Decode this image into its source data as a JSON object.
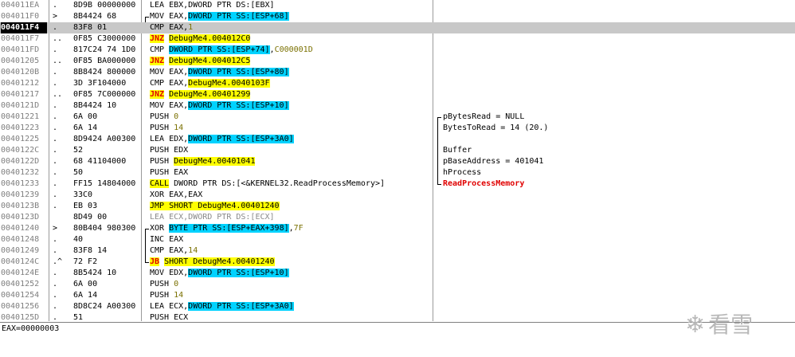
{
  "rows": [
    {
      "addr": "004011EA",
      "mark": ".",
      "hex": "8D9B 00000000",
      "asm": [
        {
          "t": "LEA EBX,DWORD PTR DS:[EBX]"
        }
      ]
    },
    {
      "addr": "004011F0",
      "mark": ">",
      "hex": "8B4424 68",
      "bracket": "top",
      "asm": [
        {
          "t": "MOV EAX,"
        },
        {
          "t": "DWORD PTR SS:[ESP+68]",
          "c": "reg"
        }
      ]
    },
    {
      "addr": "004011F4",
      "mark": ".",
      "hex": "83F8 01",
      "selected": true,
      "asm": [
        {
          "t": "CMP EAX,"
        },
        {
          "t": "1",
          "c": "num"
        }
      ]
    },
    {
      "addr": "004011F7",
      "mark": "..",
      "hex": "0F85 C3000000",
      "asm": [
        {
          "t": "JNZ",
          "c": "red"
        },
        {
          "t": " "
        },
        {
          "t": "DebugMe4.004012C0",
          "c": "mark"
        }
      ]
    },
    {
      "addr": "004011FD",
      "mark": ".",
      "hex": "817C24 74 1D0",
      "asm": [
        {
          "t": "CMP "
        },
        {
          "t": "DWORD PTR SS:[ESP+74]",
          "c": "reg"
        },
        {
          "t": ","
        },
        {
          "t": "C000001D",
          "c": "num"
        }
      ]
    },
    {
      "addr": "00401205",
      "mark": "..",
      "hex": "0F85 BA000000",
      "asm": [
        {
          "t": "JNZ",
          "c": "red"
        },
        {
          "t": " "
        },
        {
          "t": "DebugMe4.004012C5",
          "c": "mark"
        }
      ]
    },
    {
      "addr": "0040120B",
      "mark": ".",
      "hex": "8B8424 800000",
      "asm": [
        {
          "t": "MOV EAX,"
        },
        {
          "t": "DWORD PTR SS:[ESP+80]",
          "c": "reg"
        }
      ]
    },
    {
      "addr": "00401212",
      "mark": ".",
      "hex": "3D 3F104000",
      "asm": [
        {
          "t": "CMP EAX,"
        },
        {
          "t": "DebugMe4.0040103F",
          "c": "mark"
        }
      ]
    },
    {
      "addr": "00401217",
      "mark": "..",
      "hex": "0F85 7C000000",
      "asm": [
        {
          "t": "JNZ",
          "c": "red"
        },
        {
          "t": " "
        },
        {
          "t": "DebugMe4.00401299",
          "c": "mark"
        }
      ]
    },
    {
      "addr": "0040121D",
      "mark": ".",
      "hex": "8B4424 10",
      "asm": [
        {
          "t": "MOV EAX,"
        },
        {
          "t": "DWORD PTR SS:[ESP+10]",
          "c": "reg"
        }
      ]
    },
    {
      "addr": "00401221",
      "mark": ".",
      "hex": "6A 00",
      "asm": [
        {
          "t": "PUSH "
        },
        {
          "t": "0",
          "c": "num"
        }
      ],
      "comment": [
        {
          "t": "pBytesRead = NULL"
        }
      ],
      "cbracket": "top"
    },
    {
      "addr": "00401223",
      "mark": ".",
      "hex": "6A 14",
      "asm": [
        {
          "t": "PUSH "
        },
        {
          "t": "14",
          "c": "num"
        }
      ],
      "comment": [
        {
          "t": "BytesToRead = 14 (20.)"
        }
      ],
      "cbracket": "mid"
    },
    {
      "addr": "00401225",
      "mark": ".",
      "hex": "8D9424 A00300",
      "asm": [
        {
          "t": "LEA EDX,"
        },
        {
          "t": "DWORD PTR SS:[ESP+3A0]",
          "c": "reg"
        }
      ],
      "cbracket": "mid"
    },
    {
      "addr": "0040122C",
      "mark": ".",
      "hex": "52",
      "asm": [
        {
          "t": "PUSH EDX"
        }
      ],
      "comment": [
        {
          "t": "Buffer"
        }
      ],
      "cbracket": "mid"
    },
    {
      "addr": "0040122D",
      "mark": ".",
      "hex": "68 41104000",
      "asm": [
        {
          "t": "PUSH "
        },
        {
          "t": "DebugMe4.00401041",
          "c": "mark"
        }
      ],
      "comment": [
        {
          "t": "pBaseAddress = 401041"
        }
      ],
      "cbracket": "mid"
    },
    {
      "addr": "00401232",
      "mark": ".",
      "hex": "50",
      "asm": [
        {
          "t": "PUSH EAX"
        }
      ],
      "comment": [
        {
          "t": "hProcess"
        }
      ],
      "cbracket": "mid"
    },
    {
      "addr": "00401233",
      "mark": ".",
      "hex": "FF15 14804000",
      "asm": [
        {
          "t": "CALL",
          "c": "mark"
        },
        {
          "t": " DWORD PTR DS:[<&KERNEL32.ReadProcessMemory>]"
        }
      ],
      "comment": [
        {
          "t": "ReadProcessMemory",
          "c": "cmtred"
        }
      ],
      "cbracket": "bot"
    },
    {
      "addr": "00401239",
      "mark": ".",
      "hex": "33C0",
      "asm": [
        {
          "t": "XOR EAX,EAX"
        }
      ]
    },
    {
      "addr": "0040123B",
      "mark": ".",
      "hex": "EB 03",
      "asm": [
        {
          "t": "JMP SHORT DebugMe4.00401240",
          "c": "mark"
        }
      ]
    },
    {
      "addr": "0040123D",
      "mark": "",
      "hex": "8D49 00",
      "asm": [
        {
          "t": "LEA ECX,DWORD PTR DS:[ECX]",
          "c": "gray"
        }
      ]
    },
    {
      "addr": "00401240",
      "mark": ">",
      "hex": "80B404 980300",
      "bracket": "top",
      "asm": [
        {
          "t": "XOR "
        },
        {
          "t": "BYTE PTR SS:[ESP+EAX+398]",
          "c": "reg"
        },
        {
          "t": ","
        },
        {
          "t": "7F",
          "c": "num"
        }
      ]
    },
    {
      "addr": "00401248",
      "mark": ".",
      "hex": "40",
      "bracket": "mid",
      "asm": [
        {
          "t": "INC EAX"
        }
      ]
    },
    {
      "addr": "00401249",
      "mark": ".",
      "hex": "83F8 14",
      "bracket": "mid",
      "asm": [
        {
          "t": "CMP EAX,"
        },
        {
          "t": "14",
          "c": "num"
        }
      ]
    },
    {
      "addr": "0040124C",
      "mark": ".^",
      "hex": "72 F2",
      "bracket": "bot",
      "asm": [
        {
          "t": "JB",
          "c": "red"
        },
        {
          "t": " "
        },
        {
          "t": "SHORT DebugMe4.00401240",
          "c": "mark"
        }
      ]
    },
    {
      "addr": "0040124E",
      "mark": ".",
      "hex": "8B5424 10",
      "asm": [
        {
          "t": "MOV EDX,"
        },
        {
          "t": "DWORD PTR SS:[ESP+10]",
          "c": "reg"
        }
      ]
    },
    {
      "addr": "00401252",
      "mark": ".",
      "hex": "6A 00",
      "asm": [
        {
          "t": "PUSH "
        },
        {
          "t": "0",
          "c": "num"
        }
      ]
    },
    {
      "addr": "00401254",
      "mark": ".",
      "hex": "6A 14",
      "asm": [
        {
          "t": "PUSH "
        },
        {
          "t": "14",
          "c": "num"
        }
      ]
    },
    {
      "addr": "00401256",
      "mark": ".",
      "hex": "8D8C24 A00300",
      "asm": [
        {
          "t": "LEA ECX,"
        },
        {
          "t": "DWORD PTR SS:[ESP+3A0]",
          "c": "reg"
        }
      ]
    },
    {
      "addr": "0040125D",
      "mark": ".",
      "hex": "51",
      "asm": [
        {
          "t": "PUSH ECX"
        }
      ]
    }
  ],
  "status": {
    "text": "EAX=00000003"
  },
  "watermark": {
    "text": "看雪",
    "icon": "snowflake-icon"
  },
  "colors": {
    "reg_highlight": "#00d2ff",
    "jump_highlight": "#ffff00",
    "jump_text": "#e00000",
    "selection": "#c8c8c8"
  }
}
